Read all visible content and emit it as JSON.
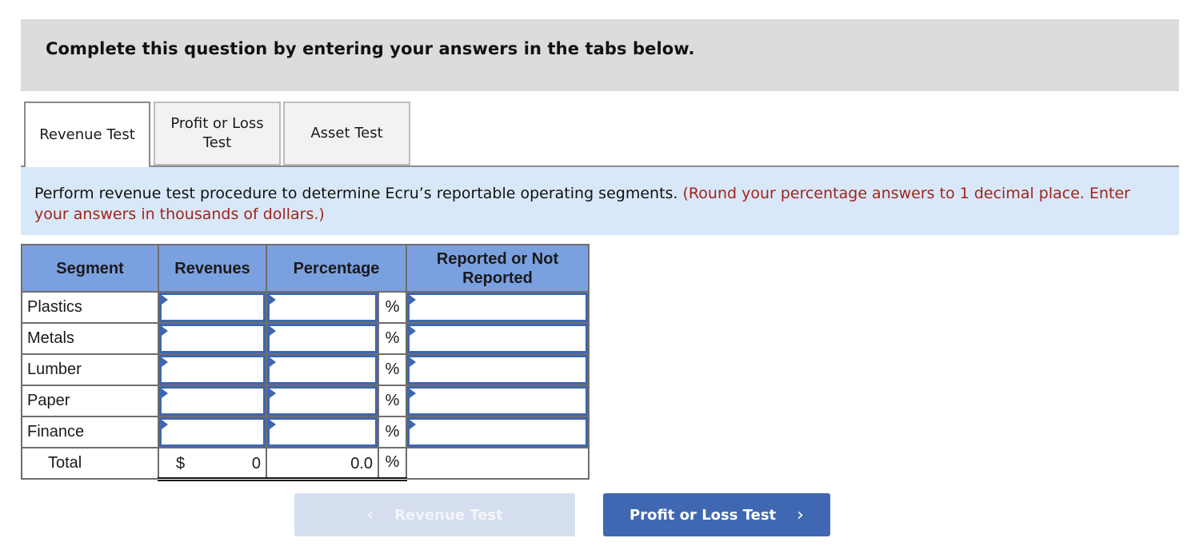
{
  "banner": {
    "text": "Complete this question by entering your answers in the tabs below."
  },
  "tabs": [
    {
      "label": "Revenue Test",
      "active": true
    },
    {
      "label": "Profit or Loss Test",
      "active": false
    },
    {
      "label": "Asset Test",
      "active": false
    }
  ],
  "instructions": {
    "main": "Perform revenue test procedure to determine Ecru’s reportable operating segments.",
    "note": "(Round your percentage answers to 1 decimal place. Enter your answers in thousands of dollars.)"
  },
  "table": {
    "headers": {
      "segment": "Segment",
      "revenues": "Revenues",
      "percentage": "Percentage",
      "reported": "Reported or Not Reported"
    },
    "percent_symbol": "%",
    "rows": [
      {
        "segment": "Plastics",
        "revenues": "",
        "percentage": "",
        "reported": ""
      },
      {
        "segment": "Metals",
        "revenues": "",
        "percentage": "",
        "reported": ""
      },
      {
        "segment": "Lumber",
        "revenues": "",
        "percentage": "",
        "reported": ""
      },
      {
        "segment": "Paper",
        "revenues": "",
        "percentage": "",
        "reported": ""
      },
      {
        "segment": "Finance",
        "revenues": "",
        "percentage": "",
        "reported": ""
      }
    ],
    "total": {
      "label": "Total",
      "currency": "$",
      "revenues": "0",
      "percentage": "0.0"
    }
  },
  "navigation": {
    "prev_label": "Revenue Test",
    "next_label": "Profit or Loss Test",
    "prev_icon": "‹",
    "next_icon": "›"
  },
  "colors": {
    "header_bg": "#7aa0e0",
    "input_border": "#3f66b0",
    "note_red": "#a1241c",
    "next_button": "#4067b2",
    "prev_button_disabled": "#d5deee"
  }
}
